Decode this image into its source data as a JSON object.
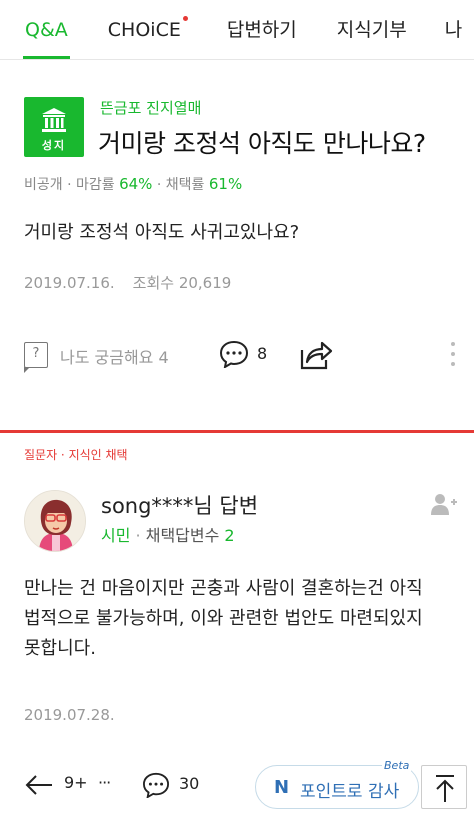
{
  "tabs": [
    {
      "label": "Q&A",
      "active": true
    },
    {
      "label": "CHOiCE",
      "new_dot": true
    },
    {
      "label": "답변하기"
    },
    {
      "label": "지식기부"
    },
    {
      "label": "나"
    }
  ],
  "question": {
    "badge_label": "성지",
    "badge_icon": "pillar-icon",
    "category": "뜬금포 진지열매",
    "title": "거미랑 조정석 아직도 만나나요?",
    "meta": {
      "visibility": "비공개",
      "close_rate_label": "마감률",
      "close_rate": "64%",
      "adopt_rate_label": "채택률",
      "adopt_rate": "61%"
    },
    "body": "거미랑 조정석 아직도 사귀고있나요?",
    "date": "2019.07.16.",
    "views": "조회수 20,619"
  },
  "actions": {
    "curious_icon_text": "?",
    "curious_label": "나도 궁금해요 4",
    "comment_count": "8"
  },
  "answer": {
    "badge": "질문자 · 지식인 채택",
    "author": "song****님 답변",
    "rank": "시민",
    "adopted_label": "채택답변수",
    "adopted_count": "2",
    "body": "만나는 건 마음이지만 곤충과 사람이 결혼하는건 아직 법적으로 불가능하며, 이와 관련한 법안도 마련되있지 못합니다.",
    "date": "2019.07.28."
  },
  "bottom_bar": {
    "nav_count": "9+",
    "more": "···",
    "comment_count": "30",
    "point_icon": "N",
    "point_label": "포인트로 감사",
    "beta": "Beta"
  },
  "colors": {
    "accent_green": "#19b82f",
    "alert_red": "#e53935",
    "point_blue": "#2f6fb5"
  }
}
